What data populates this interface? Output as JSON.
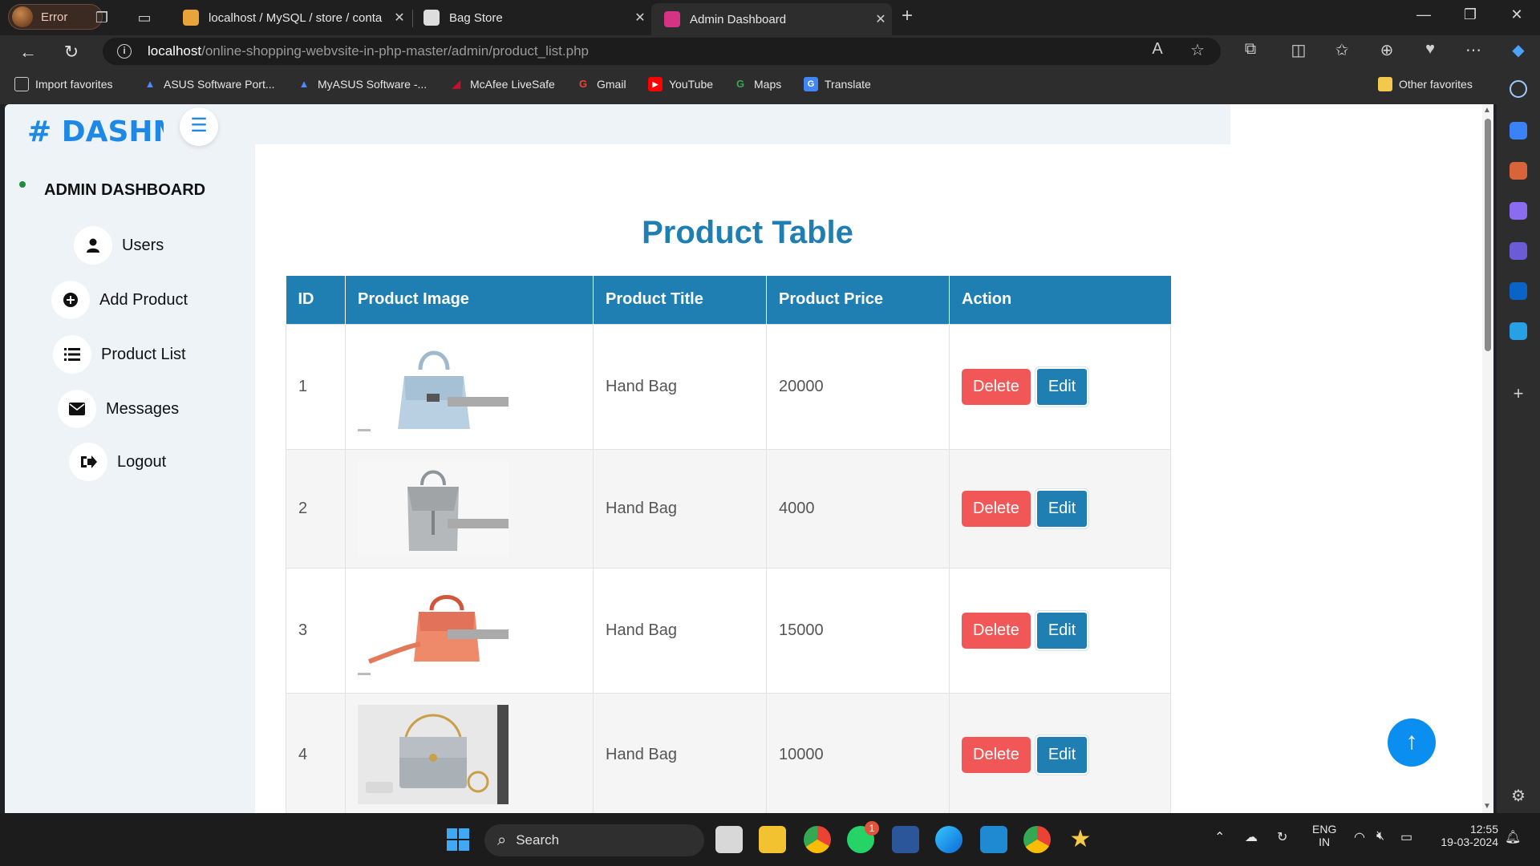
{
  "browser": {
    "profile_label": "Error",
    "tabs": [
      {
        "title": "localhost / MySQL / store / conta",
        "favicon_color": "#e8a33a"
      },
      {
        "title": "Bag Store",
        "favicon_color": "#dddddd"
      },
      {
        "title": "Admin Dashboard",
        "favicon_color": "#d63384"
      }
    ],
    "url_host": "localhost",
    "url_path": "/online-shopping-webvsite-in-php-master/admin/product_list.php",
    "favorites": [
      {
        "label": "Import favorites",
        "icon": "import-icon"
      },
      {
        "label": "ASUS Software Port...",
        "icon": "asus-icon"
      },
      {
        "label": "MyASUS Software -...",
        "icon": "asus-icon"
      },
      {
        "label": "McAfee LiveSafe",
        "icon": "mcafee-icon"
      },
      {
        "label": "Gmail",
        "icon": "google-icon"
      },
      {
        "label": "YouTube",
        "icon": "youtube-icon"
      },
      {
        "label": "Maps",
        "icon": "google-icon"
      },
      {
        "label": "Translate",
        "icon": "translate-icon"
      }
    ],
    "other_favorites": "Other favorites"
  },
  "sidebar": {
    "brand": "# DASHM",
    "section_title": "ADMIN DASHBOARD",
    "items": [
      {
        "label": "Users",
        "icon": "user-icon"
      },
      {
        "label": "Add Product",
        "icon": "plus-circle-icon"
      },
      {
        "label": "Product List",
        "icon": "list-icon"
      },
      {
        "label": "Messages",
        "icon": "envelope-icon"
      },
      {
        "label": "Logout",
        "icon": "logout-icon"
      }
    ]
  },
  "main": {
    "title": "Product Table",
    "columns": [
      "ID",
      "Product Image",
      "Product Title",
      "Product Price",
      "Action"
    ],
    "rows": [
      {
        "id": "1",
        "title": "Hand Bag",
        "price": "20000",
        "image": "light-blue-handbag"
      },
      {
        "id": "2",
        "title": "Hand Bag",
        "price": "4000",
        "image": "grey-backpack"
      },
      {
        "id": "3",
        "title": "Hand Bag",
        "price": "15000",
        "image": "orange-handbag"
      },
      {
        "id": "4",
        "title": "Hand Bag",
        "price": "10000",
        "image": "grey-chain-bag"
      }
    ],
    "delete_label": "Delete",
    "edit_label": "Edit"
  },
  "taskbar": {
    "search_placeholder": "Search",
    "whatsapp_badge": "1",
    "lang": "ENG",
    "region": "IN",
    "time": "12:55",
    "date": "19-03-2024"
  },
  "colors": {
    "accent": "#1f7fb3",
    "delete": "#f25757",
    "brand": "#1e88e5"
  }
}
